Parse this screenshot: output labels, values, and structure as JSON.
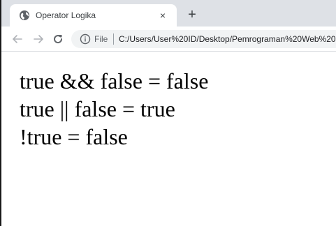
{
  "browser": {
    "tab": {
      "title": "Operator Logika",
      "close_label": "×"
    },
    "new_tab_label": "+",
    "toolbar": {
      "url_scheme": "File",
      "url": "C:/Users/User%20ID/Desktop/Pemrograman%20Web%20"
    }
  },
  "page": {
    "lines": [
      "true && false = false",
      "true || false = true",
      "!true = false"
    ]
  }
}
